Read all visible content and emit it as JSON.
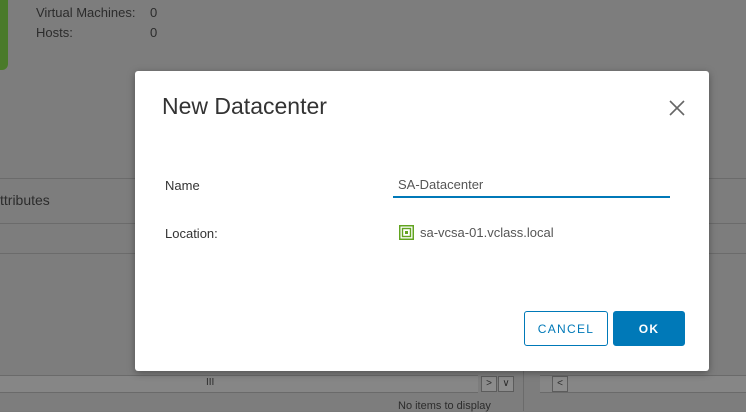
{
  "background": {
    "stats": [
      {
        "label": "Virtual Machines:",
        "value": "0"
      },
      {
        "label": "Hosts:",
        "value": "0"
      }
    ],
    "attributes_tab": "ttributes",
    "scroll_grip": "III",
    "scroll_right": ">",
    "scroll_down": "∨",
    "scroll_left": "<",
    "no_items": "No items to display"
  },
  "dialog": {
    "title": "New Datacenter",
    "name_label": "Name",
    "name_value": "SA-Datacenter",
    "location_label": "Location:",
    "location_value": "sa-vcsa-01.vclass.local",
    "location_icon": "vcenter-icon",
    "cancel_label": "CANCEL",
    "ok_label": "OK"
  },
  "colors": {
    "accent": "#0079b8",
    "vcenter_icon": "#62a420",
    "overlay": "#7d7d7d"
  }
}
